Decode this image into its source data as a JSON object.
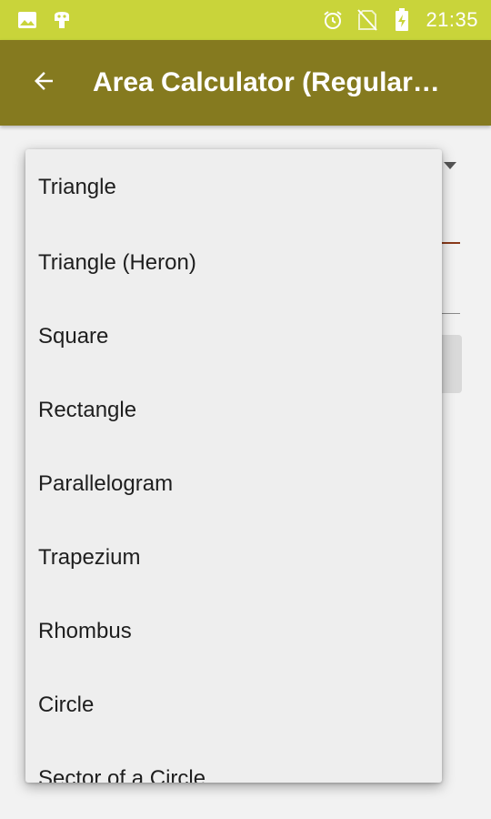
{
  "status_bar": {
    "time": "21:35",
    "icons": [
      "image-icon",
      "android-debug-icon",
      "alarm-icon",
      "no-sim-icon",
      "battery-charging-icon"
    ]
  },
  "app_bar": {
    "title": "Area Calculator (Regular…",
    "back_icon": "arrow-back-icon"
  },
  "colors": {
    "status_bar": "#c9d43a",
    "app_bar": "#857a1f",
    "dropdown_bg": "#eeeeee"
  },
  "dropdown": {
    "items": [
      "Triangle",
      "Triangle (Heron)",
      "Square",
      "Rectangle",
      "Parallelogram",
      "Trapezium",
      "Rhombus",
      "Circle",
      "Sector of a Circle"
    ]
  }
}
